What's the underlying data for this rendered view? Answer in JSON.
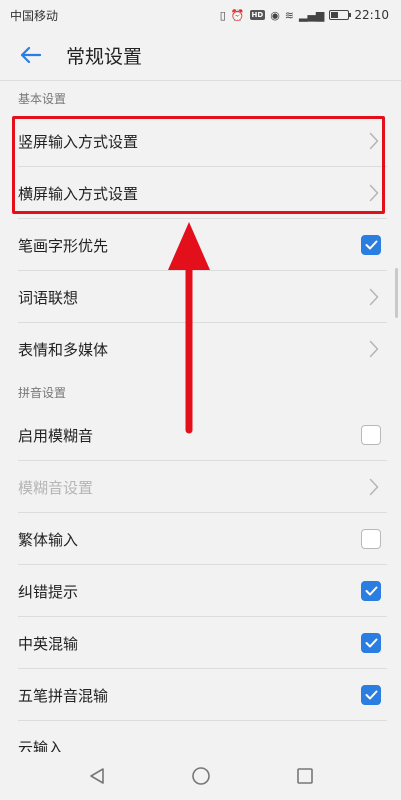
{
  "status_bar": {
    "carrier": "中国移动",
    "time": "22:10",
    "hd_label": "HD"
  },
  "header": {
    "title": "常规设置"
  },
  "sections": [
    {
      "title": "基本设置",
      "items": [
        {
          "label": "竖屏输入方式设置",
          "control": "chevron"
        },
        {
          "label": "横屏输入方式设置",
          "control": "chevron"
        },
        {
          "label": "笔画字形优先",
          "control": "checkbox",
          "checked": true
        },
        {
          "label": "词语联想",
          "control": "chevron"
        },
        {
          "label": "表情和多媒体",
          "control": "chevron"
        }
      ]
    },
    {
      "title": "拼音设置",
      "items": [
        {
          "label": "启用模糊音",
          "control": "checkbox",
          "checked": false
        },
        {
          "label": "模糊音设置",
          "control": "chevron",
          "disabled": true
        },
        {
          "label": "繁体输入",
          "control": "checkbox",
          "checked": false
        },
        {
          "label": "纠错提示",
          "control": "checkbox",
          "checked": true
        },
        {
          "label": "中英混输",
          "control": "checkbox",
          "checked": true
        },
        {
          "label": "五笔拼音混输",
          "control": "checkbox",
          "checked": true
        },
        {
          "label": "云输入",
          "control": "none"
        }
      ]
    }
  ],
  "colors": {
    "accent": "#2a7de1",
    "highlight": "#e3101b"
  },
  "battery_level": 0.4
}
